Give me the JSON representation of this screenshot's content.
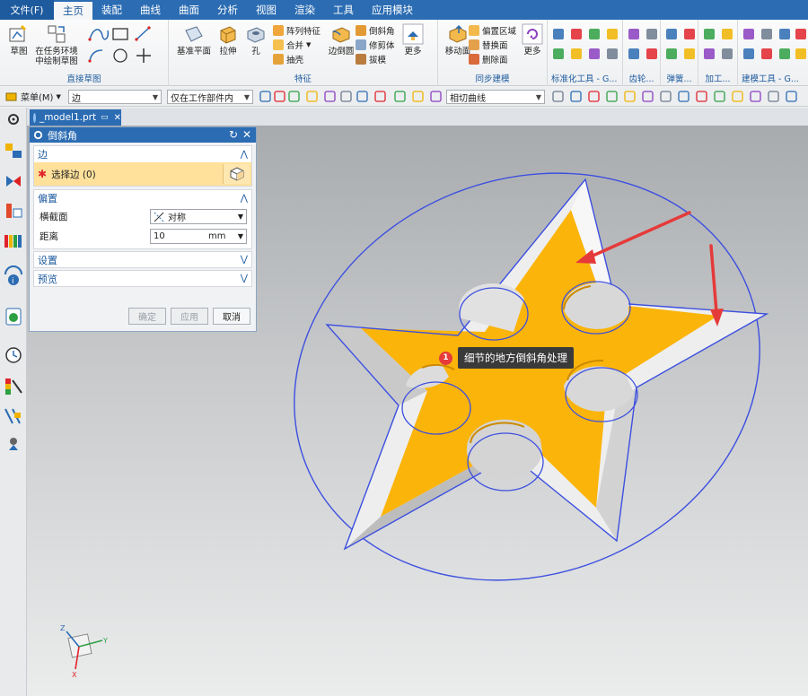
{
  "menubar": {
    "file": "文件(F)",
    "tabs": [
      "主页",
      "装配",
      "曲线",
      "曲面",
      "分析",
      "视图",
      "渲染",
      "工具",
      "应用模块"
    ],
    "active_index": 0
  },
  "ribbon": {
    "groups": {
      "direct_sketch": "直接草图",
      "feature": "特征",
      "sync_modeling": "同步建模",
      "std_tools": "标准化工具 - G...",
      "gear": "齿轮...",
      "spring": "弹簧...",
      "machining": "加工...",
      "modeling_tools": "建模工具 - G..."
    },
    "buttons": {
      "sketch": "草图",
      "task_env_sketch": "在任务环境中绘制草图",
      "datum_plane": "基准平面",
      "extrude": "拉伸",
      "hole": "孔",
      "pattern_feature": "阵列特征",
      "unite": "合并",
      "shell": "抽壳",
      "edge_blend": "边倒圆",
      "chamfer": "倒斜角",
      "trim_body": "修剪体",
      "draft": "拔模",
      "more": "更多",
      "move_face": "移动面",
      "offset_region": "偏置区域",
      "replace_face": "替换面",
      "delete_face": "删除面",
      "more2": "更多"
    }
  },
  "toolbar2": {
    "menu": "菜单(M)",
    "filter": "边",
    "scope": "仅在工作部件内",
    "curve_rule": "相切曲线"
  },
  "document": {
    "tab": "_model1.prt"
  },
  "dialog": {
    "title": "倒斜角",
    "edge_section": "边",
    "select_edge": "选择边 (0)",
    "offset_section": "偏置",
    "cross_section_label": "横截面",
    "cross_section_value": "对称",
    "distance_label": "距离",
    "distance_value": "10",
    "distance_unit": "mm",
    "settings_section": "设置",
    "preview_section": "预览",
    "ok": "确定",
    "apply": "应用",
    "cancel": "取消"
  },
  "callout": {
    "number": "1",
    "text": "细节的地方倒斜角处理"
  },
  "triad": {
    "x": "X",
    "y": "Y",
    "z": "Z"
  },
  "colors": {
    "accent": "#2b6cb3",
    "star_face": "#fbb40a",
    "edge_blue": "#3c4fe0",
    "arrow_red": "#e53a3a",
    "selection_yellow": "#ffe19b"
  }
}
